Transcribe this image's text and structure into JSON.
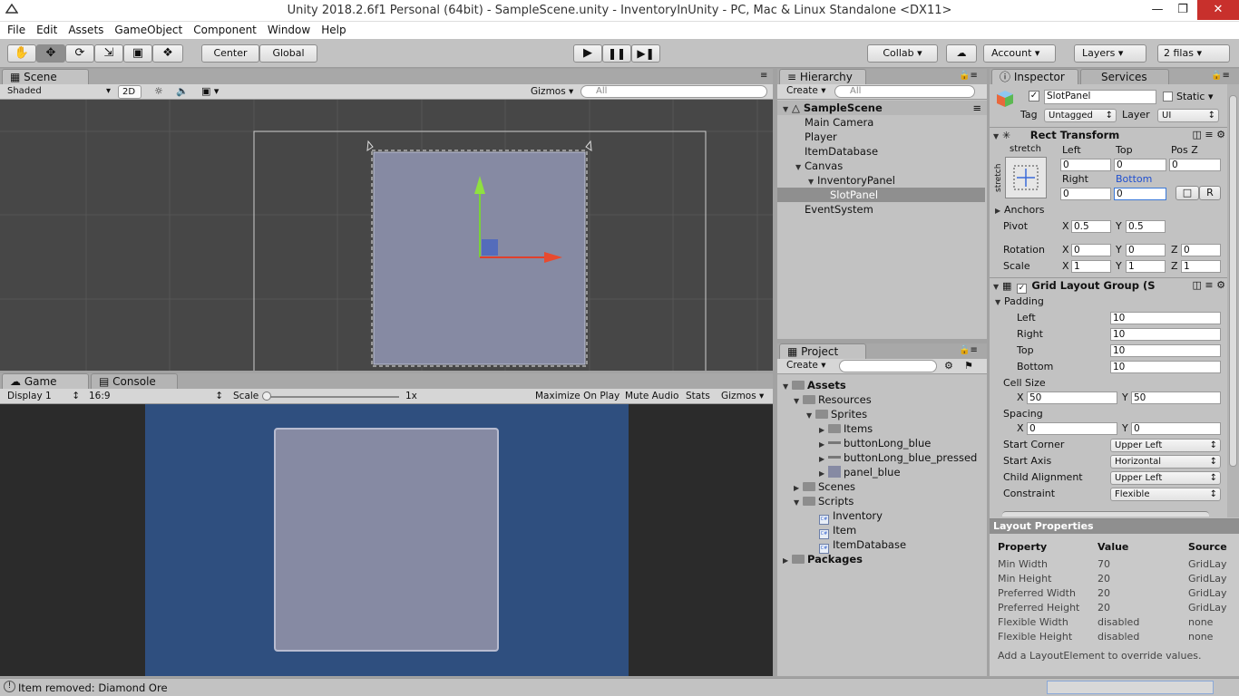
{
  "window": {
    "title": "Unity 2018.2.6f1 Personal (64bit) - SampleScene.unity - InventoryInUnity - PC, Mac & Linux Standalone <DX11>"
  },
  "menu": [
    "File",
    "Edit",
    "Assets",
    "GameObject",
    "Component",
    "Window",
    "Help"
  ],
  "toolbar": {
    "center": "Center",
    "global": "Global",
    "collab": "Collab",
    "account": "Account",
    "layers": "Layers",
    "layout": "2 filas"
  },
  "scene": {
    "tab": "Scene",
    "shading": "Shaded",
    "mode2d": "2D",
    "gizmos": "Gizmos",
    "search_placeholder": "All"
  },
  "game": {
    "tab": "Game",
    "console_tab": "Console",
    "display": "Display 1",
    "aspect": "16:9",
    "scale_label": "Scale",
    "scale_value": "1x",
    "maximize": "Maximize On Play",
    "mute": "Mute Audio",
    "stats": "Stats",
    "gizmos": "Gizmos"
  },
  "hierarchy": {
    "tab": "Hierarchy",
    "create": "Create",
    "search_placeholder": "All",
    "scene": "SampleScene",
    "items": [
      {
        "label": "Main Camera",
        "indent": 0
      },
      {
        "label": "Player",
        "indent": 0
      },
      {
        "label": "ItemDatabase",
        "indent": 0
      },
      {
        "label": "Canvas",
        "indent": 0,
        "expanded": true
      },
      {
        "label": "InventoryPanel",
        "indent": 1,
        "expanded": true
      },
      {
        "label": "SlotPanel",
        "indent": 2,
        "selected": true
      },
      {
        "label": "EventSystem",
        "indent": 0
      }
    ]
  },
  "project": {
    "tab": "Project",
    "create": "Create",
    "items": [
      {
        "label": "Assets",
        "kind": "root"
      },
      {
        "label": "Resources",
        "kind": "folder"
      },
      {
        "label": "Sprites",
        "kind": "folder"
      },
      {
        "label": "Items",
        "kind": "folder"
      },
      {
        "label": "buttonLong_blue",
        "kind": "sprite"
      },
      {
        "label": "buttonLong_blue_pressed",
        "kind": "sprite"
      },
      {
        "label": "panel_blue",
        "kind": "sprite"
      },
      {
        "label": "Scenes",
        "kind": "folder"
      },
      {
        "label": "Scripts",
        "kind": "folder"
      },
      {
        "label": "Inventory",
        "kind": "script"
      },
      {
        "label": "Item",
        "kind": "script"
      },
      {
        "label": "ItemDatabase",
        "kind": "script"
      },
      {
        "label": "Packages",
        "kind": "root"
      }
    ]
  },
  "inspector": {
    "tab": "Inspector",
    "services_tab": "Services",
    "name": "SlotPanel",
    "static": "Static",
    "tag_label": "Tag",
    "tag": "Untagged",
    "layer_label": "Layer",
    "layer": "UI",
    "rect": {
      "title": "Rect Transform",
      "stretch": "stretch",
      "left_label": "Left",
      "top_label": "Top",
      "posz_label": "Pos Z",
      "left": "0",
      "top": "0",
      "posz": "0",
      "right_label": "Right",
      "bottom_label": "Bottom",
      "right": "0",
      "bottom": "0",
      "r_button": "R",
      "anchors": "Anchors",
      "pivot_label": "Pivot",
      "pivot_x": "0.5",
      "pivot_y": "0.5",
      "rotation_label": "Rotation",
      "rot_x": "0",
      "rot_y": "0",
      "rot_z": "0",
      "scale_label": "Scale",
      "scale_x": "1",
      "scale_y": "1",
      "scale_z": "1",
      "x": "X",
      "y": "Y",
      "z": "Z"
    },
    "grid": {
      "title": "Grid Layout Group (S",
      "padding": "Padding",
      "pad_rows": [
        {
          "label": "Left",
          "value": "10"
        },
        {
          "label": "Right",
          "value": "10"
        },
        {
          "label": "Top",
          "value": "10"
        },
        {
          "label": "Bottom",
          "value": "10"
        }
      ],
      "cell_size": "Cell Size",
      "cell_x": "50",
      "cell_y": "50",
      "spacing": "Spacing",
      "sp_x": "0",
      "sp_y": "0",
      "enums": [
        {
          "label": "Start Corner",
          "value": "Upper Left"
        },
        {
          "label": "Start Axis",
          "value": "Horizontal"
        },
        {
          "label": "Child Alignment",
          "value": "Upper Left"
        },
        {
          "label": "Constraint",
          "value": "Flexible"
        }
      ]
    },
    "layout_props": {
      "title": "Layout Properties",
      "headers": [
        "Property",
        "Value",
        "Source"
      ],
      "rows": [
        [
          "Min Width",
          "70",
          "GridLay"
        ],
        [
          "Min Height",
          "20",
          "GridLay"
        ],
        [
          "Preferred Width",
          "20",
          "GridLay"
        ],
        [
          "Preferred Height",
          "20",
          "GridLay"
        ],
        [
          "Flexible Width",
          "disabled",
          "none"
        ],
        [
          "Flexible Height",
          "disabled",
          "none"
        ]
      ],
      "note": "Add a LayoutElement to override values."
    }
  },
  "status": {
    "text": "Item removed: Diamond Ore"
  },
  "colors": {
    "game_bg": "#2f4f7f",
    "panel": "#868aa3",
    "scene_bg": "#474747"
  }
}
